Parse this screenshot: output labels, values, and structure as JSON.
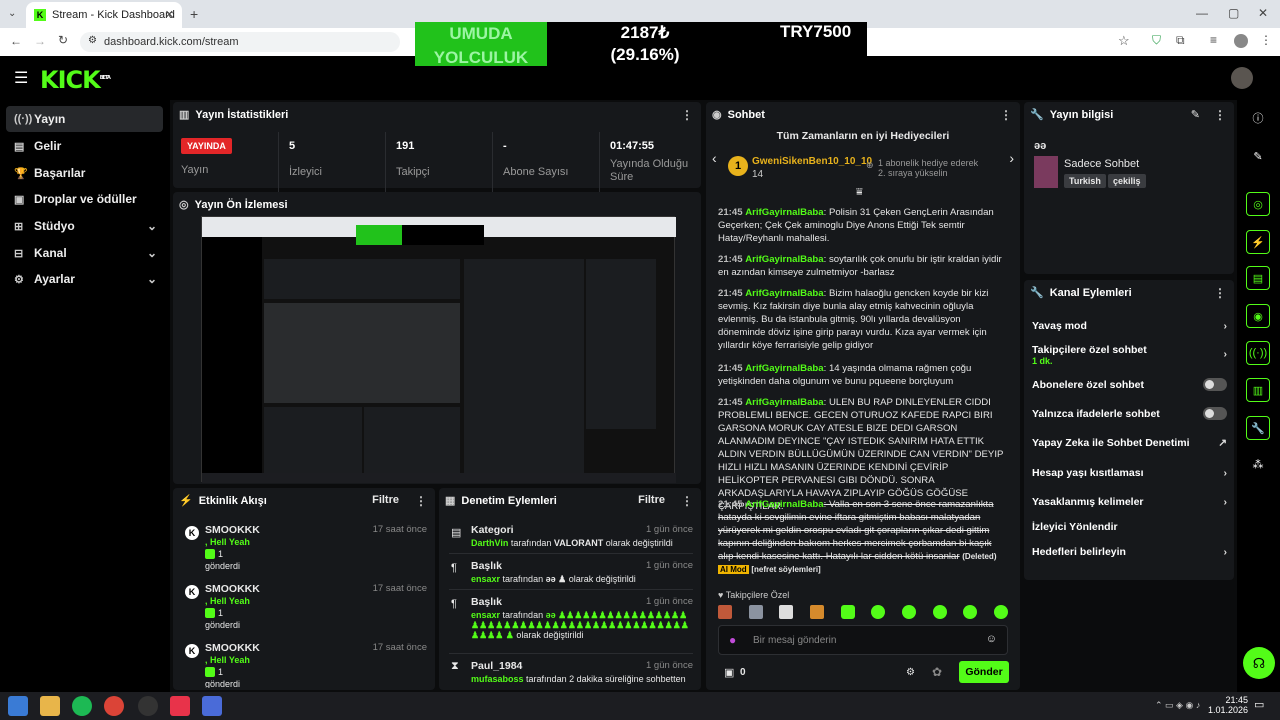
{
  "browser": {
    "tab_title": "Stream - Kick Dashboard",
    "url": "dashboard.kick.com/stream"
  },
  "overlay": {
    "campaign_line1": "UMUDA",
    "campaign_line2": "YOLCULUK",
    "amount": "2187₺",
    "percent": "(29.16%)",
    "goal": "TRY7500"
  },
  "brand": {
    "logo": "KICK",
    "beta": "BETA",
    "accent": "#53fc18"
  },
  "sidebar": {
    "items": [
      {
        "label": "Yayın",
        "icon": "broadcast-icon"
      },
      {
        "label": "Gelir",
        "icon": "wallet-icon"
      },
      {
        "label": "Başarılar",
        "icon": "trophy-icon"
      },
      {
        "label": "Droplar ve ödüller",
        "icon": "gift-icon"
      },
      {
        "label": "Stüdyo",
        "icon": "grid-icon"
      },
      {
        "label": "Kanal",
        "icon": "channel-icon"
      },
      {
        "label": "Ayarlar",
        "icon": "gear-icon"
      }
    ]
  },
  "stats": {
    "title": "Yayın İstatistikleri",
    "live_badge": "YAYINDA",
    "status_label": "Yayın",
    "viewers_value": "5",
    "viewers_label": "İzleyici",
    "followers_value": "191",
    "followers_label": "Takipçi",
    "subs_value": "-",
    "subs_label": "Abone Sayısı",
    "uptime_value": "01:47:55",
    "uptime_label": "Yayında Olduğu Süre"
  },
  "preview": {
    "title": "Yayın Ön İzlemesi"
  },
  "activity": {
    "title": "Etkinlik Akışı",
    "filter": "Filtre",
    "items": [
      {
        "user": "SMOOKKK",
        "time": "17 saat önce",
        "message": ", Hell Yeah",
        "count": "1",
        "action": "gönderdi"
      },
      {
        "user": "SMOOKKK",
        "time": "17 saat önce",
        "message": ", Hell Yeah",
        "count": "1",
        "action": "gönderdi"
      },
      {
        "user": "SMOOKKK",
        "time": "17 saat önce",
        "message": ", Hell Yeah",
        "count": "1",
        "action": "gönderdi"
      }
    ]
  },
  "moderation": {
    "title": "Denetim Eylemleri",
    "filter": "Filtre",
    "items": [
      {
        "heading": "Kategori",
        "time": "1 gün önce",
        "actor": "DarthVin",
        "text1": "tarafından",
        "value": "VALORANT",
        "text2": "olarak değiştirildi"
      },
      {
        "heading": "Başlık",
        "time": "1 gün önce",
        "actor": "ensaxr",
        "text1": "tarafından",
        "value": "əə ♟",
        "text2": "olarak değiştirildi"
      },
      {
        "heading": "Başlık",
        "time": "1 gün önce",
        "actor": "ensaxr",
        "text1": "tarafından",
        "value": "əə ♟♟♟♟♟♟♟♟♟♟♟♟♟♟♟♟♟♟♟♟♟♟♟♟♟♟♟♟♟♟♟♟♟♟♟♟♟♟♟♟♟♟♟♟♟♟♟ ♟",
        "text2": "olarak değiştirildi"
      },
      {
        "heading": "Paul_1984",
        "time": "1 gün önce",
        "actor": "mufasaboss",
        "text1": "tarafından 2 dakika süreliğine sohbetten",
        "value": "",
        "text2": ""
      }
    ]
  },
  "chat": {
    "title": "Sohbet",
    "gifters_title": "Tüm Zamanların en iyi Hediyecileri",
    "top_gifter": "GweniSikenBen10_10_10",
    "top_gifter_count": "14",
    "next_rank_text": "1 abonelik hediye ederek 2. sıraya yükselin",
    "messages": [
      {
        "time": "21:45",
        "user": "ArifGayirnalBaba",
        "text": ": Polisin 31 Çeken GençLerin Arasından Geçerken; Çek Çek aminoglu Diye Anons Ettiği Tek semtir Hatay/Reyhanlı mahallesi."
      },
      {
        "time": "21:45",
        "user": "ArifGayirnalBaba",
        "text": ": soytarılık çok onurlu bir iştir kraldan iyidir en azından kimseye zulmetmiyor -barlasz"
      },
      {
        "time": "21:45",
        "user": "ArifGayirnalBaba",
        "text": ": Bizim halaoğlu gencken koyde bir kizi sevmiş. Kız fakirsin diye bunla alay etmiş kahvecinin oğluyla evlenmiş. Bu da istanbula gitmiş. 90lı yıllarda devalüsyon döneminde döviz işine girip parayı vurdu. Kıza ayar vermek için yıllardır köye ferrarisiyle gelip gidiyor"
      },
      {
        "time": "21:45",
        "user": "ArifGayirnalBaba",
        "text": ": 14 yaşında olmama rağmen çoğu yetişkinden daha olgunum ve bunu pqueene borçluyum"
      },
      {
        "time": "21:45",
        "user": "ArifGayirnalBaba",
        "text": ": ULEN BU RAP DINLEYENLER CIDDI PROBLEMLI BENCE. GECEN OTURUOZ KAFEDE RAPCI BIRI GARSONA MORUK CAY ATESLE BIZE DEDI GARSON ALANMADIM DEYINCE \"ÇAY ISTEDIK SANIRIM HATA ETTIK ALDIN VERDIN BÜLLÜGÜMÜN ÜZERINDE CAN VERDIN\" DEYIP HIZLI HIZLI MASANIN ÜZERINDE KENDINİ ÇEVİRİP HELİKOPTER PERVANESI GIBI DÖNDÜ. SONRA ARKADAŞLARIYLA HAVAYA ZIPLAYIP GÖĞÜS GÖĞÜSE ÇARPIŞTILAR."
      },
      {
        "time": "21:45",
        "user": "ArifGayirnalBaba",
        "text": ": Valla en son 3 sene önce ramazanlıkta hatayda ki sevgilimin evine iftara gitmiştim babası malatyadan yürüyerek mi geldin orospu evladı git çorapların çıkar dedi gittim kapının deliğinden bakıom herkes mercimek çorbamdan bi kaşık alıp kendi kasesine kattı. Hatayılı lar cidden kötü insanlar"
      }
    ],
    "deleted_tag": "(Deleted)",
    "ai_mod_tag": "AI Mod",
    "reason_tag": "[nefret söylemleri]",
    "followers_only": "Takipçilere Özel",
    "input_placeholder": "Bir mesaj gönderin",
    "points": "0",
    "send_button": "Gönder"
  },
  "stream_info": {
    "title": "Yayın bilgisi",
    "stream_title": "əə",
    "stream_name": "Sadece Sohbet",
    "tags": [
      "Turkish",
      "çekiliş"
    ]
  },
  "channel_actions": {
    "title": "Kanal Eylemleri",
    "slow_mode": "Yavaş mod",
    "followers_only": "Takipçilere özel sohbet",
    "followers_only_sub": "1 dk.",
    "subs_only": "Abonelere özel sohbet",
    "emotes_only": "Yalnızca ifadelerle sohbet",
    "ai_moderation": "Yapay Zeka ile Sohbet Denetimi",
    "age_restriction": "Hesap yaşı kısıtlaması",
    "banned_words": "Yasaklanmış kelimeler",
    "redirect": "İzleyici Yönlendir",
    "goals": "Hedefleri belirleyin"
  },
  "taskbar": {
    "time": "21:45",
    "date": "1.01.2026"
  }
}
